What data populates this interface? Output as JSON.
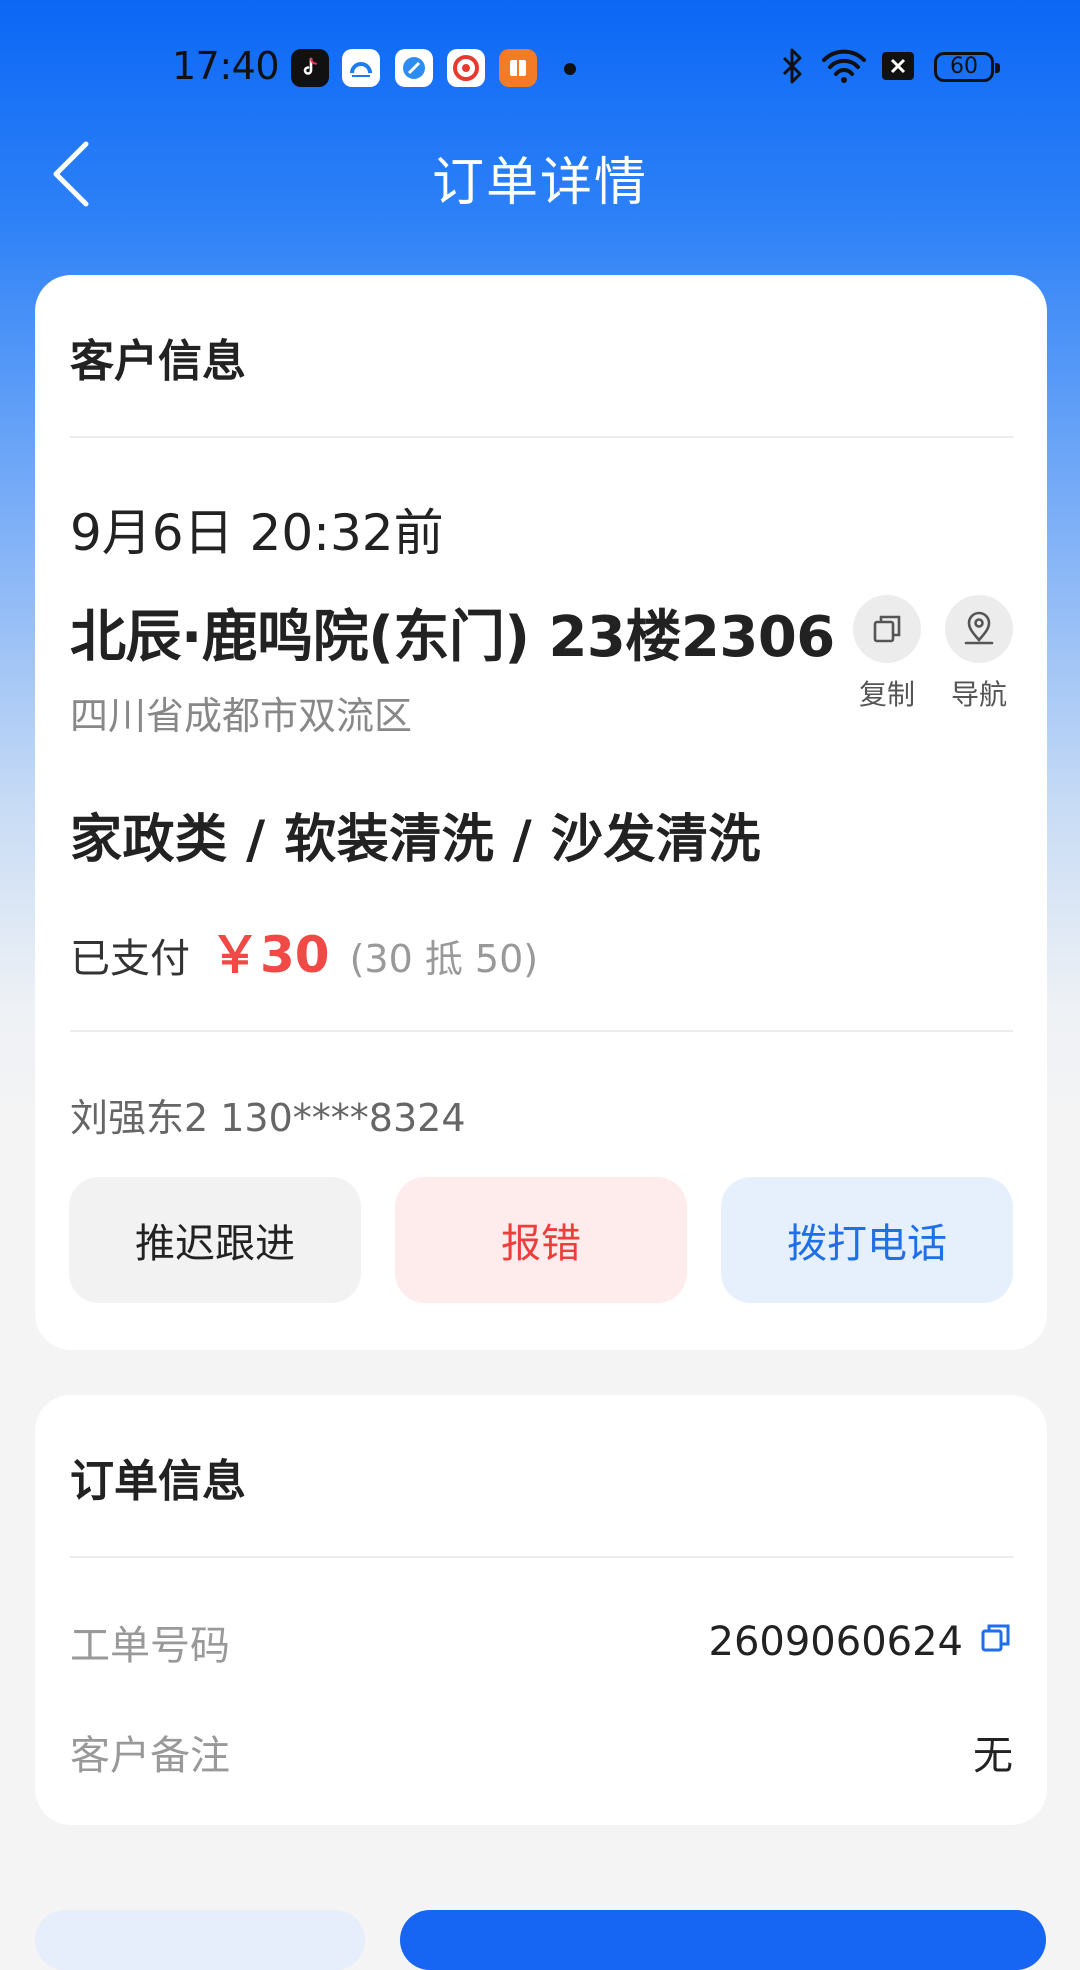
{
  "status_bar": {
    "time": "17:40",
    "battery": "60",
    "apps": [
      "tiktok-icon",
      "cloud-app-icon",
      "blue-app-icon",
      "red-swirl-app-icon",
      "orange-book-app-icon"
    ]
  },
  "nav": {
    "title": "订单详情"
  },
  "customer": {
    "heading": "客户信息",
    "deadline": "9月6日 20:32前",
    "address_title": "北辰·鹿鸣院(东门) 23楼2306",
    "address_sub": "四川省成都市双流区",
    "copy_label": "复制",
    "navigate_label": "导航",
    "service": "家政类 / 软装清洗 / 沙发清洗",
    "pay_label": "已支付",
    "pay_amount": "￥30",
    "pay_note": "(30 抵 50)",
    "contact": "刘强东2 130****8324",
    "btn_delay": "推迟跟进",
    "btn_error": "报错",
    "btn_call": "拨打电话"
  },
  "order": {
    "heading": "订单信息",
    "order_no_label": "工单号码",
    "order_no_value": "2609060624",
    "remark_label": "客户备注",
    "remark_value": "无"
  },
  "colors": {
    "brand_blue": "#0b67f5",
    "price_red": "#f04a46",
    "call_blue": "#1f6fe8"
  }
}
